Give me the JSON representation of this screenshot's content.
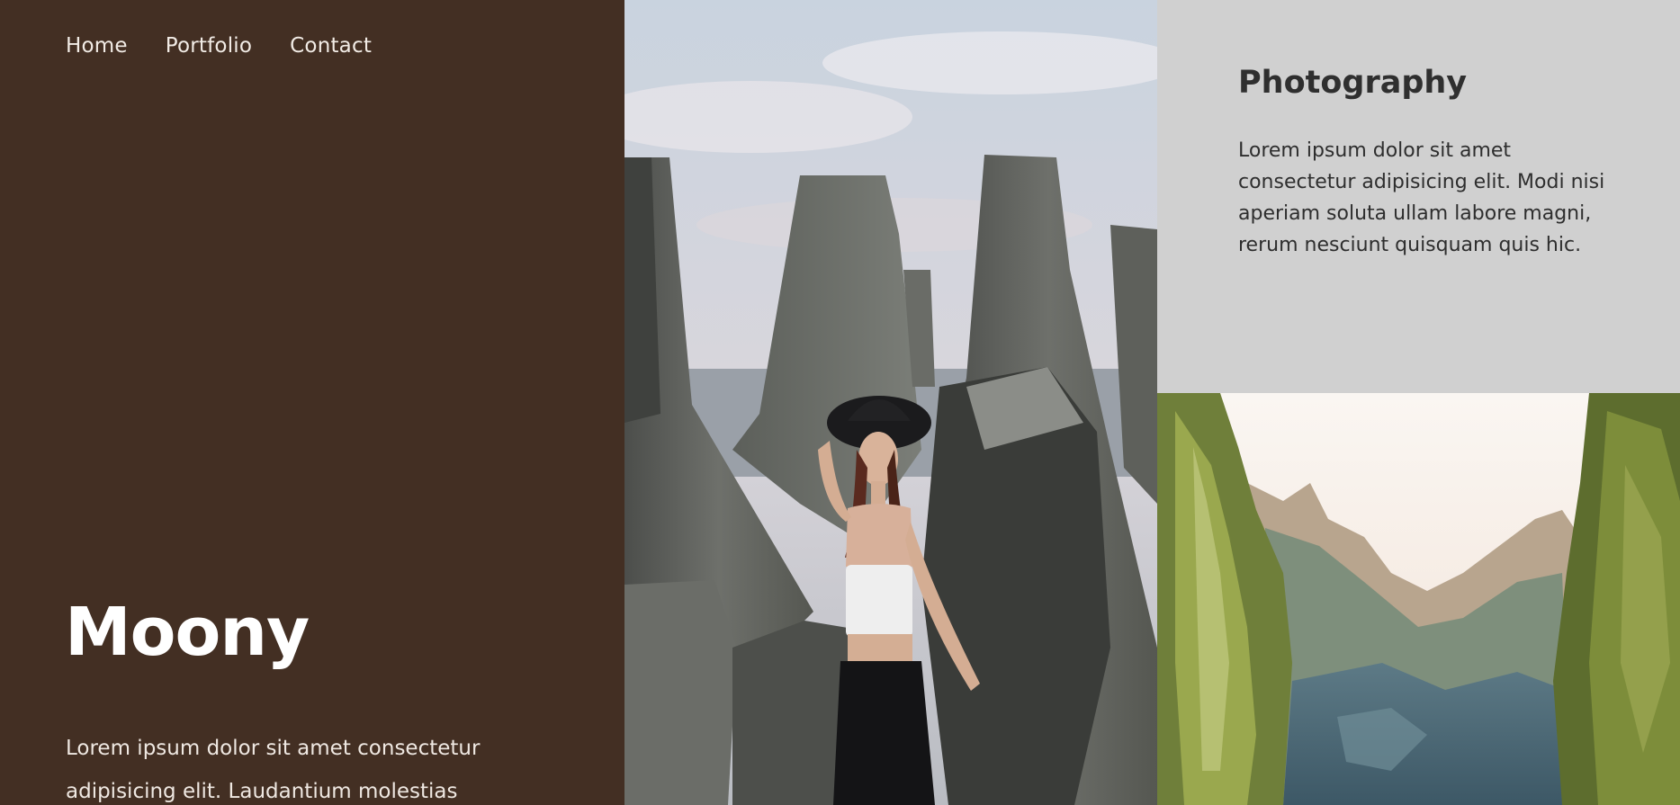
{
  "nav": {
    "items": [
      {
        "label": "Home"
      },
      {
        "label": "Portfolio"
      },
      {
        "label": "Contact"
      }
    ]
  },
  "hero": {
    "title": "Moony",
    "text": "Lorem ipsum dolor sit amet consectetur adipisicing elit. Laudantium molestias"
  },
  "card": {
    "title": "Photography",
    "text": "Lorem ipsum dolor sit amet consectetur adipisicing elit. Modi nisi aperiam soluta ullam labore magni, rerum nesciunt quisquam quis hic."
  },
  "images": {
    "portrait": "woman in black hat among concrete tetrapods by the sea",
    "forest": "forest canyon with tall pine trees and bright sky"
  },
  "colors": {
    "left_panel": "#432f23",
    "card_bg": "#d0d0d0",
    "card_text": "#2e2e2e",
    "hero_text": "#ffffff"
  }
}
